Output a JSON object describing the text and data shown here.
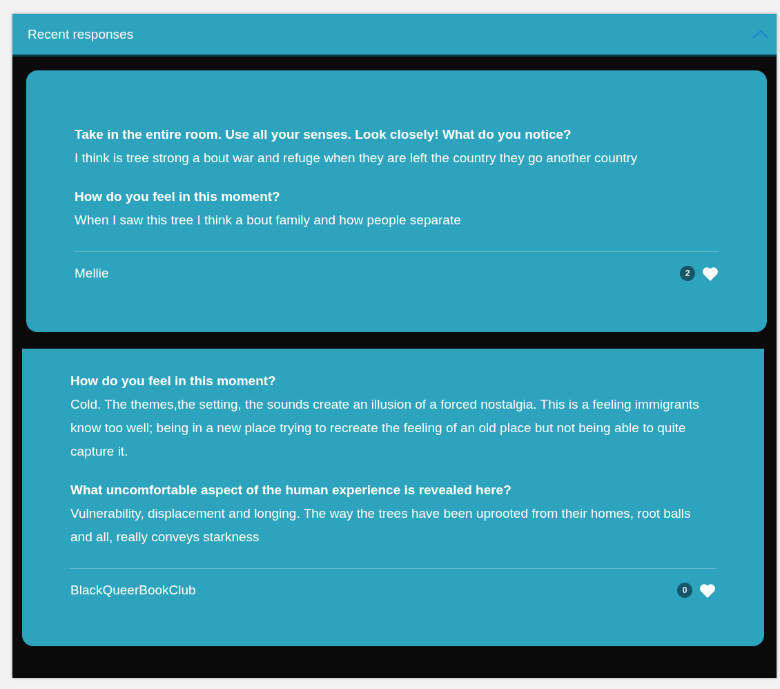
{
  "panel": {
    "title": "Recent responses",
    "expanded": true
  },
  "responses": [
    {
      "entries": [
        {
          "question": "Take in the entire room. Use all your senses. Look closely! What do you notice?",
          "answer": "I think is tree strong a bout war and refuge when they are left the country they go another country"
        },
        {
          "question": "How do you feel in this moment?",
          "answer": "When I saw this tree I think a bout family and how people separate"
        }
      ],
      "author": "Mellie",
      "likes": "2"
    },
    {
      "entries": [
        {
          "question": "How do you feel in this moment?",
          "answer": "Cold. The themes,the setting, the sounds create an illusion of a forced nostalgia. This is a feeling immigrants know too well; being in a new place trying to recreate the feeling of an old place but not being able to quite capture it."
        },
        {
          "question": "What uncomfortable aspect of the human experience is revealed here?",
          "answer": "Vulnerability, displacement and longing. The way the trees have been uprooted from their homes, root balls and all, really conveys starkness"
        }
      ],
      "author": "BlackQueerBookClub",
      "likes": "0"
    }
  ]
}
